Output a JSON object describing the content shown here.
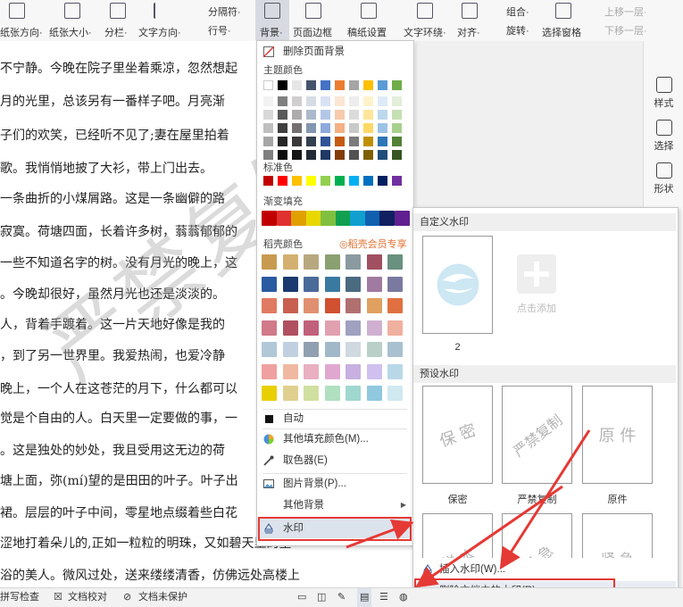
{
  "toolbar": {
    "buttons": [
      {
        "label": "纸张方向·"
      },
      {
        "label": "纸张大小·"
      },
      {
        "label": "分栏·"
      },
      {
        "label": "文字方向·"
      },
      {
        "label": "分隔符·"
      },
      {
        "label": "行号·"
      },
      {
        "label": "背景·"
      },
      {
        "label": "页面边框"
      },
      {
        "label": "稿纸设置"
      },
      {
        "label": "文字环绕·"
      },
      {
        "label": "对齐·"
      },
      {
        "label": "组合·"
      },
      {
        "label": "旋转·"
      },
      {
        "label": "选择窗格"
      },
      {
        "label": "上移一层·"
      },
      {
        "label": "下移一层·"
      }
    ]
  },
  "document": {
    "lines": [
      "不宁静。今晚在院子里坐着乘凉，忽然想起",
      "月的光里，总该另有一番样子吧。月亮渐",
      "子们的欢笑，已经听不见了;妻在屋里拍着",
      "歌。我悄悄地披了大衫，带上门出去。",
      "一条曲折的小煤屑路。这是一条幽僻的路",
      "寂寞。荷塘四面，长着许多树，蓊蓊郁郁的",
      "一些不知道名字的树。没有月光的晚上，这",
      "。今晚却很好，虽然月光也还是淡淡的。",
      "人，背着手踱着。这一片天地好像是我的",
      "，到了另一世界里。我爱热闹，也爱冷静",
      "晚上，一个人在这苍茫的月下，什么都可以",
      "觉是个自由的人。白天里一定要做的事，一",
      "。这是独处的妙处，我且受用这无边的荷",
      "塘上面，弥(mí)望的是田田的叶子。叶子出",
      "裙。层层的叶子中间，零星地点缀着些白花",
      "涩地打着朵儿的,正如一粒粒的明珠，又如碧天里的星",
      "浴的美人。微风过处，送来缕缕清香，仿佛远处高楼上"
    ],
    "watermark_text": "严禁复制"
  },
  "right_panel": {
    "items": [
      {
        "label": "样式"
      },
      {
        "label": "选择"
      },
      {
        "label": "形状"
      }
    ]
  },
  "background_menu": {
    "remove_background": "删除页面背景",
    "theme_colors_label": "主题颜色",
    "standard_colors_label": "标准色",
    "gradient_label": "渐变填充",
    "docer_colors_label": "稻壳颜色",
    "docer_member_label": "稻壳会员专享",
    "items": [
      {
        "label": "自动"
      },
      {
        "label": "其他填充颜色(M)..."
      },
      {
        "label": "取色器(E)"
      },
      {
        "label": "图片背景(P)..."
      },
      {
        "label": "其他背景"
      },
      {
        "label": "水印"
      }
    ],
    "theme_top_row": [
      "#ffffff",
      "#000000",
      "#e7e6e6",
      "#44546a",
      "#4472c4",
      "#ed7d31",
      "#a5a5a5",
      "#ffc000",
      "#5b9bd5",
      "#70ad47"
    ],
    "theme_shades": [
      [
        "#f2f2f2",
        "#7f7f7f",
        "#d0cece",
        "#d6dce4",
        "#d9e2f3",
        "#fbe5d5",
        "#ededed",
        "#fff2cc",
        "#deebf6",
        "#e2efd9"
      ],
      [
        "#d8d8d8",
        "#595959",
        "#aeabab",
        "#adb9ca",
        "#b4c6e7",
        "#f7caac",
        "#dbdbdb",
        "#fee599",
        "#bdd7ee",
        "#c5e0b3"
      ],
      [
        "#bfbfbf",
        "#3f3f3f",
        "#757070",
        "#8496b0",
        "#8eaadb",
        "#f4b183",
        "#c9c9c9",
        "#ffd965",
        "#9cc3e5",
        "#a8d08d"
      ],
      [
        "#a5a5a5",
        "#262626",
        "#3a3838",
        "#323f4f",
        "#2f5496",
        "#c55a11",
        "#7b7b7b",
        "#bf9000",
        "#2e75b5",
        "#538135"
      ],
      [
        "#7f7f7f",
        "#0c0c0c",
        "#171616",
        "#222a35",
        "#1f3864",
        "#833c0b",
        "#525252",
        "#7f6000",
        "#1e4e79",
        "#375623"
      ]
    ],
    "standard_colors": [
      "#c00000",
      "#ff0000",
      "#ffc000",
      "#ffff00",
      "#92d050",
      "#00b050",
      "#00b0f0",
      "#0070c0",
      "#002060",
      "#7030a0"
    ],
    "gradient_colors": [
      "#c00000",
      "#e03030",
      "#e0a000",
      "#e8d800",
      "#80c040",
      "#10a050",
      "#10a0d0",
      "#1060b0",
      "#102060",
      "#602090"
    ],
    "docer_colors": [
      [
        "#c89a50",
        "#d4b070",
        "#b8a880",
        "#8aa070",
        "#8a9aa0",
        "#a05060",
        "#6a9080"
      ],
      [
        "#2a5aa0",
        "#1a3a70",
        "#4a6a9a",
        "#3a7aa0",
        "#4a6a80",
        "#a07aa0",
        "#7a7aa0"
      ],
      [
        "#e07a60",
        "#c86050",
        "#e09070",
        "#d05030",
        "#b07070",
        "#e0a060",
        "#e07040"
      ],
      [
        "#d07a8a",
        "#b05060",
        "#c0607a",
        "#e0a0b0",
        "#a0a0c0",
        "#d0b0d0",
        "#f0b0a0"
      ],
      [
        "#b0c8d8",
        "#c0d0e0",
        "#90a0b0",
        "#a0b8c8",
        "#d0d8e0",
        "#b8d0c8",
        "#a8c0d0"
      ],
      [
        "#f0a0a0",
        "#f0b8a0",
        "#e8b0c0",
        "#e0a8d0",
        "#c8b0e0",
        "#d0c0f0",
        "#b8d8e8"
      ],
      [
        "#e8d000",
        "#e0d090",
        "#d0e0a0",
        "#b0e0c0",
        "#a0d8d0",
        "#90c8e0",
        "#d0e8f0"
      ]
    ]
  },
  "watermark_panel": {
    "custom_header": "自定义水印",
    "custom_thumb_caption": "2",
    "add_label": "点击添加",
    "preset_header": "预设水印",
    "presets": [
      {
        "caption": "保密",
        "text": "保  密"
      },
      {
        "caption": "严禁复制",
        "text": "严禁复制"
      },
      {
        "caption": "原件",
        "text": "原  件"
      }
    ],
    "preset_row2": [
      {
        "text": "样 本"
      },
      {
        "text": "紧 急"
      },
      {
        "text": "紧 急"
      }
    ],
    "insert_watermark": "插入水印(W)...",
    "delete_watermark": "删除文档中的水印(R)"
  },
  "status_bar": {
    "items": [
      {
        "label": "拼写检查"
      },
      {
        "label": "文档校对"
      },
      {
        "label": "文档未保护"
      }
    ]
  },
  "colors": {
    "highlight_red": "#e53935",
    "arrow_red": "#e53935",
    "accent_blue": "#2f5496"
  }
}
